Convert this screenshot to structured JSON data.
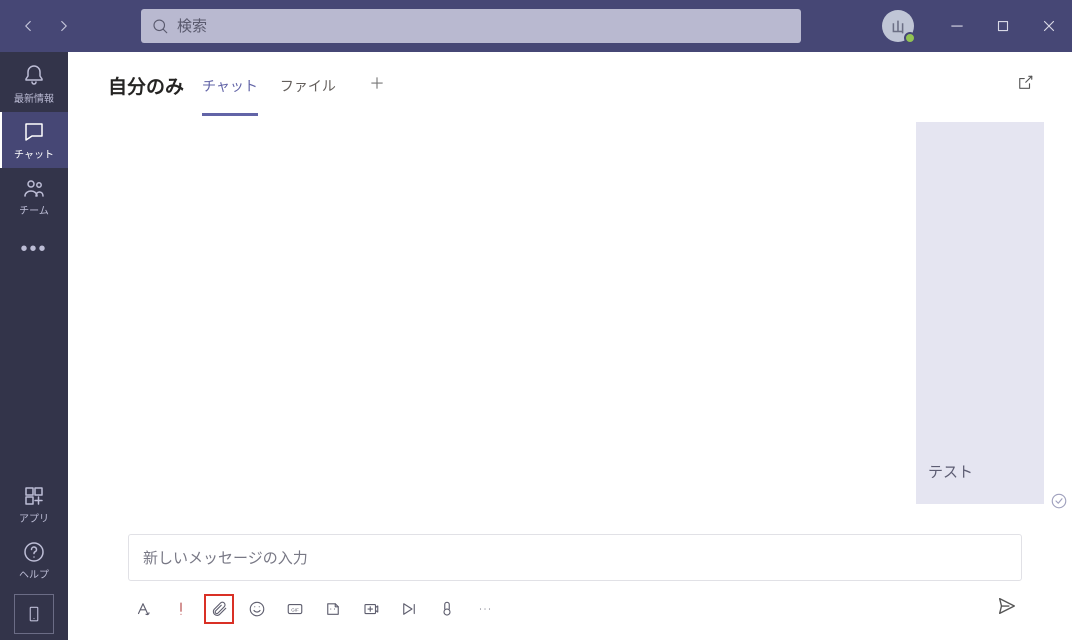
{
  "search": {
    "placeholder": "検索"
  },
  "avatar": {
    "initial": "山"
  },
  "rail": {
    "activity": "最新情報",
    "chat": "チャット",
    "teams": "チーム",
    "apps": "アプリ",
    "help": "ヘルプ"
  },
  "header": {
    "title": "自分のみ",
    "tabs": {
      "chat": "チャット",
      "files": "ファイル"
    }
  },
  "message": {
    "text": "テスト"
  },
  "compose": {
    "placeholder": "新しいメッセージの入力"
  }
}
